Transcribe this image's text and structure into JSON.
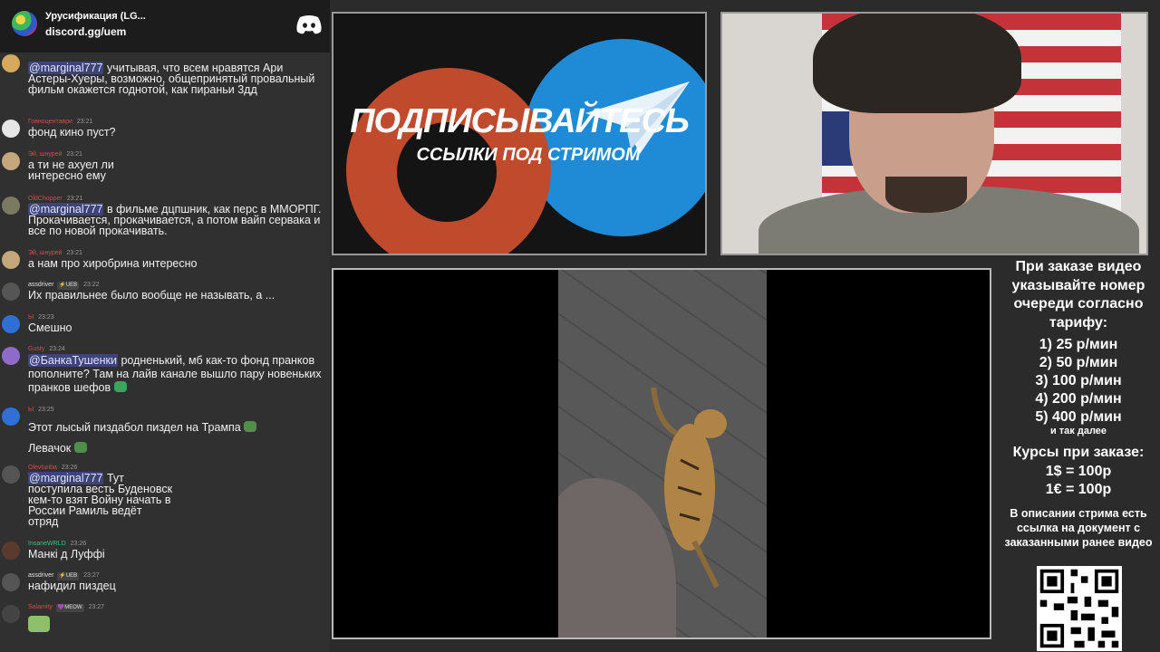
{
  "discord": {
    "server_name": "Урусификация (LG...",
    "invite": "discord.gg/uem"
  },
  "chat": {
    "messages": [
      {
        "user": "",
        "time": "",
        "text": "учитывая, что всем нравятся Ари Астеры-Хуеры, возможно, общепринятый провальный фильм окажется годнотой, как пираньи 3дд",
        "mention": "@marginal777",
        "color": "#d24b4b",
        "avatar": "#d7a95c"
      },
      {
        "user": "Говноцентаври",
        "time": "23:21",
        "text": "фонд кино пуст?",
        "mention": "",
        "color": "#d24b4b",
        "avatar": "#e6e6e6"
      },
      {
        "user": "Эй, шнурей",
        "time": "23:21",
        "text": "а ти не ахуел ли интересно ему",
        "mention": "",
        "color": "#d24b4b",
        "avatar": "#c4a77a"
      },
      {
        "user": "OldChopper",
        "time": "23:21",
        "text": "в фильме дцпшник, как перс в ММОРПГ. Прокачивается, прокачивается, а потом вайп серв­ака и все по новой прокачивать.",
        "mention": "@marginal777",
        "color": "#d24b4b",
        "avatar": "#7a7a60"
      },
      {
        "user": "Эй, шнурей",
        "time": "23:21",
        "text": "а нам про хиробрина интересно",
        "mention": "",
        "color": "#d24b4b",
        "avatar": "#c4a77a"
      },
      {
        "user": "assdriver",
        "badge": "⚡UEB",
        "time": "23:22",
        "text": "Их правильнее было вообще не называть, а ...",
        "mention": "",
        "color": "#e0e0e0",
        "avatar": "#555555"
      },
      {
        "user": "Ы",
        "time": "23:23",
        "text": "Смешно",
        "mention": "",
        "color": "#d24b4b",
        "avatar": "#2f6fd6"
      },
      {
        "user": "Gusty",
        "time": "23:24",
        "text": "родненький, мб как-то фонд пранков пополните? Там на лайв канале вышло пару новеньких пранков шефов",
        "mention": "@БанкаТушенки",
        "color": "#d24b4b",
        "avatar": "#8f6bc9"
      },
      {
        "user": "Ы",
        "time": "23:25",
        "text": "Этот лысый пиздабол пиздел на Трампа",
        "mention": "",
        "color": "#d24b4b",
        "avatar": "#2f6fd6",
        "extra": "Левачок"
      },
      {
        "user": "Olevturiba",
        "time": "23:26",
        "text": "Тут поступила весть Буденовск кем-то взят Войну начать в России Рамиль ведёт отряд",
        "mention": "@marginal777",
        "color": "#d24b4b",
        "avatar": "#555555"
      },
      {
        "user": "InsaneWRLD",
        "time": "23:26",
        "text": "Манкі д Луффі",
        "mention": "",
        "color": "#3fbf7f",
        "avatar": "#5a3a2c"
      },
      {
        "user": "assdriver",
        "badge": "⚡UEB",
        "time": "23:27",
        "text": "нафидил пиздец",
        "mention": "",
        "color": "#e0e0e0",
        "avatar": "#555555"
      },
      {
        "user": "Salamity",
        "badge": "💜MEOW",
        "time": "23:27",
        "text": "",
        "mention": "",
        "color": "#d24b4b",
        "avatar": "#444444"
      }
    ]
  },
  "promo": {
    "title": "ПОДПИСЫВАЙТЕСЬ",
    "subtitle": "ССЫЛКИ ПОД СТРИМОМ",
    "orange": "#c04a2c",
    "blue": "#1f8ad6"
  },
  "info": {
    "header": "При заказе видео указывайте номер очереди согласно тарифу:",
    "tariffs": [
      "1) 25 р/мин",
      "2) 50 р/мин",
      "3) 100 р/мин",
      "4) 200 р/мин",
      "5) 400 р/мин"
    ],
    "tariff_more": "и так далее",
    "rates_header": "Курсы при заказе:",
    "rates": [
      "1$ = 100р",
      "1€ = 100р"
    ],
    "footer": "В описании стрима есть ссылка на документ с заказанными ранее видео"
  }
}
